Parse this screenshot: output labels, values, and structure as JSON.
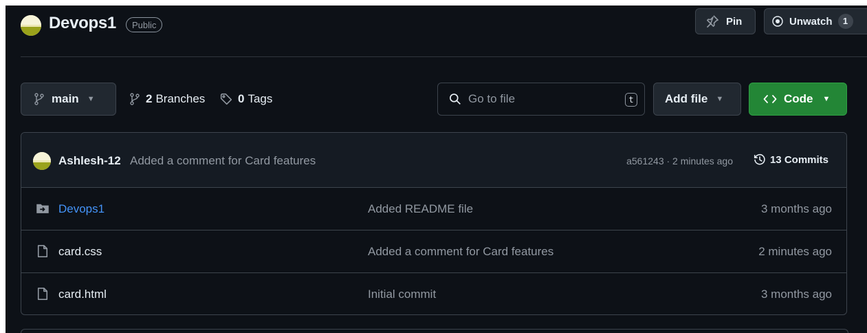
{
  "repo": {
    "name": "Devops1",
    "visibility": "Public"
  },
  "header_actions": {
    "pin_label": "Pin",
    "unwatch_label": "Unwatch",
    "watch_count": "1"
  },
  "toolbar": {
    "branch_name": "main",
    "branches_count": "2",
    "branches_label": "Branches",
    "tags_count": "0",
    "tags_label": "Tags",
    "search_placeholder": "Go to file",
    "search_shortcut": "t",
    "add_file_label": "Add file",
    "code_label": "Code"
  },
  "latest_commit": {
    "author": "Ashlesh-12",
    "message": "Added a comment for Card features",
    "hash_and_time": "a561243 · 2 minutes ago",
    "commits_label": "13 Commits"
  },
  "files": [
    {
      "type": "folder",
      "name": "Devops1",
      "commit_message": "Added README file",
      "age": "3 months ago"
    },
    {
      "type": "file",
      "name": "card.css",
      "commit_message": "Added a comment for Card features",
      "age": "2 minutes ago"
    },
    {
      "type": "file",
      "name": "card.html",
      "commit_message": "Initial commit",
      "age": "3 months ago"
    }
  ],
  "icons": {
    "branch": "git-branch-icon",
    "tag": "tag-icon",
    "search": "search-icon",
    "pin": "pin-icon",
    "eye": "eye-icon",
    "history": "history-icon",
    "folder": "folder-icon",
    "file": "file-icon"
  },
  "colors": {
    "background": "#0d1117",
    "border": "#3d444d",
    "link_blue": "#4493f8",
    "code_green": "#238636",
    "muted_text": "#9198a1"
  }
}
